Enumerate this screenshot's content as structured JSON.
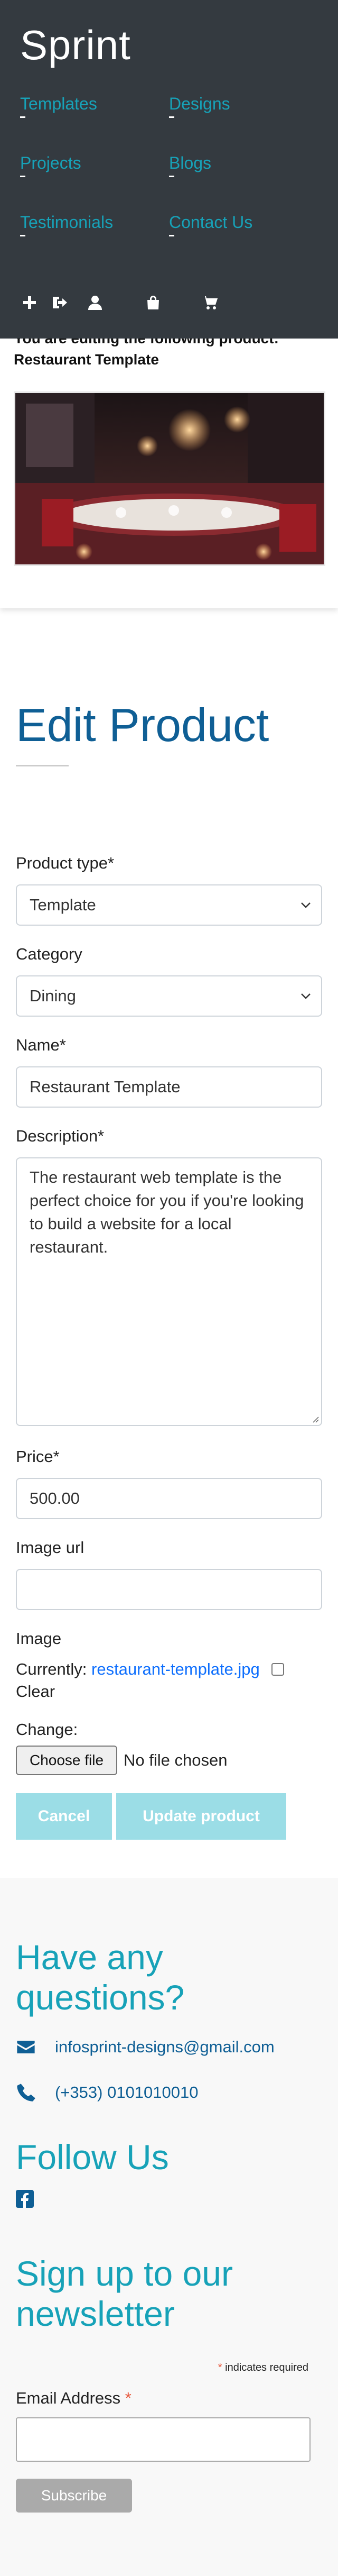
{
  "header": {
    "brand": "Sprint",
    "nav": {
      "templates": "Templates",
      "designs": "Designs",
      "projects": "Projects",
      "blogs": "Blogs",
      "testimonials": "Testimonials",
      "contact": "Contact Us"
    },
    "icons": [
      "plus-icon",
      "sign-out-icon",
      "user-icon",
      "bag-icon",
      "cart-icon"
    ]
  },
  "preview": {
    "editing_line": "You are editing the following product:",
    "product_name": "Restaurant Template"
  },
  "form": {
    "title": "Edit Product",
    "product_type_label": "Product type*",
    "product_type_value": "Template",
    "category_label": "Category",
    "category_value": "Dining",
    "name_label": "Name*",
    "name_value": "Restaurant Template",
    "description_label": "Description*",
    "description_value": "The restaurant web template is the perfect choice for you if you're looking to build a website for a local restaurant.",
    "price_label": "Price*",
    "price_value": "500.00",
    "image_url_label": "Image url",
    "image_url_value": "",
    "image_label": "Image",
    "currently_label": "Currently:",
    "current_file": "restaurant-template.jpg",
    "clear_label": "Clear",
    "change_label": "Change:",
    "choose_file_label": "Choose file",
    "no_file_label": "No file chosen",
    "cancel_label": "Cancel",
    "update_label": "Update product"
  },
  "footer": {
    "questions_heading": "Have any questions?",
    "email": "infosprint-designs@gmail.com",
    "phone": "(+353) 0101010010",
    "follow_heading": "Follow Us",
    "newsletter_heading": "Sign up to our newsletter",
    "required_note": "indicates required",
    "email_label": "Email Address",
    "subscribe_label": "Subscribe"
  },
  "colors": {
    "header_bg": "#343a40",
    "accent": "#17a2b8",
    "title_blue": "#0f5f95",
    "button_disabled": "#9bdde6"
  }
}
